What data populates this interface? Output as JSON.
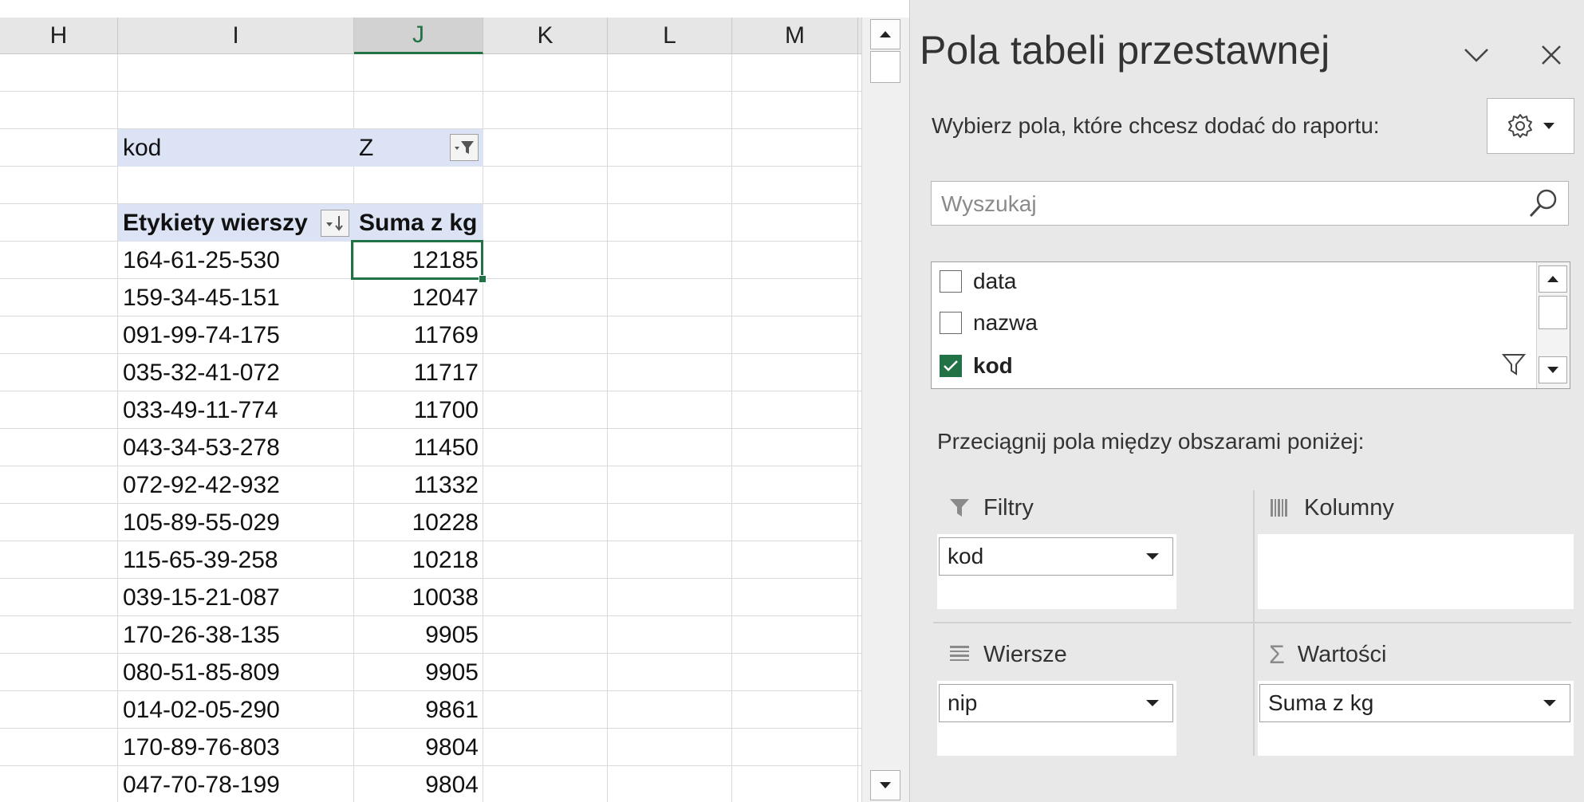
{
  "grid": {
    "columns": [
      "H",
      "I",
      "J",
      "K",
      "L",
      "M"
    ],
    "selected_column": "J",
    "filter_row": {
      "label": "kod",
      "value": "Z"
    },
    "pivot_header": {
      "row_labels": "Etykiety wierszy",
      "values": "Suma z kg"
    },
    "rows": [
      {
        "nip": "164-61-25-530",
        "kg": "12185"
      },
      {
        "nip": "159-34-45-151",
        "kg": "12047"
      },
      {
        "nip": "091-99-74-175",
        "kg": "11769"
      },
      {
        "nip": "035-32-41-072",
        "kg": "11717"
      },
      {
        "nip": "033-49-11-774",
        "kg": "11700"
      },
      {
        "nip": "043-34-53-278",
        "kg": "11450"
      },
      {
        "nip": "072-92-42-932",
        "kg": "11332"
      },
      {
        "nip": "105-89-55-029",
        "kg": "10228"
      },
      {
        "nip": "115-65-39-258",
        "kg": "10218"
      },
      {
        "nip": "039-15-21-087",
        "kg": "10038"
      },
      {
        "nip": "170-26-38-135",
        "kg": "9905"
      },
      {
        "nip": "080-51-85-809",
        "kg": "9905"
      },
      {
        "nip": "014-02-05-290",
        "kg": "9861"
      },
      {
        "nip": "170-89-76-803",
        "kg": "9804"
      },
      {
        "nip": "047-70-78-199",
        "kg": "9804"
      }
    ],
    "icons": {
      "filter_active": "filter-active-icon",
      "sort_desc": "sort-descending-icon"
    },
    "accent": "#217346",
    "pivot_fill": "#dce3f5"
  },
  "pane": {
    "title": "Pola tabeli przestawnej",
    "choose_label": "Wybierz pola, które chcesz dodać do raportu:",
    "search_placeholder": "Wyszukaj",
    "fields": [
      {
        "label": "data",
        "checked": false
      },
      {
        "label": "nazwa",
        "checked": false
      },
      {
        "label": "kod",
        "checked": true
      }
    ],
    "drag_label": "Przeciągnij pola między obszarami poniżej:",
    "areas": {
      "filters": {
        "title": "Filtry",
        "items": [
          "kod"
        ]
      },
      "columns": {
        "title": "Kolumny",
        "items": []
      },
      "rows": {
        "title": "Wiersze",
        "items": [
          "nip"
        ]
      },
      "values": {
        "title": "Wartości",
        "items": [
          "Suma z kg"
        ]
      }
    }
  }
}
